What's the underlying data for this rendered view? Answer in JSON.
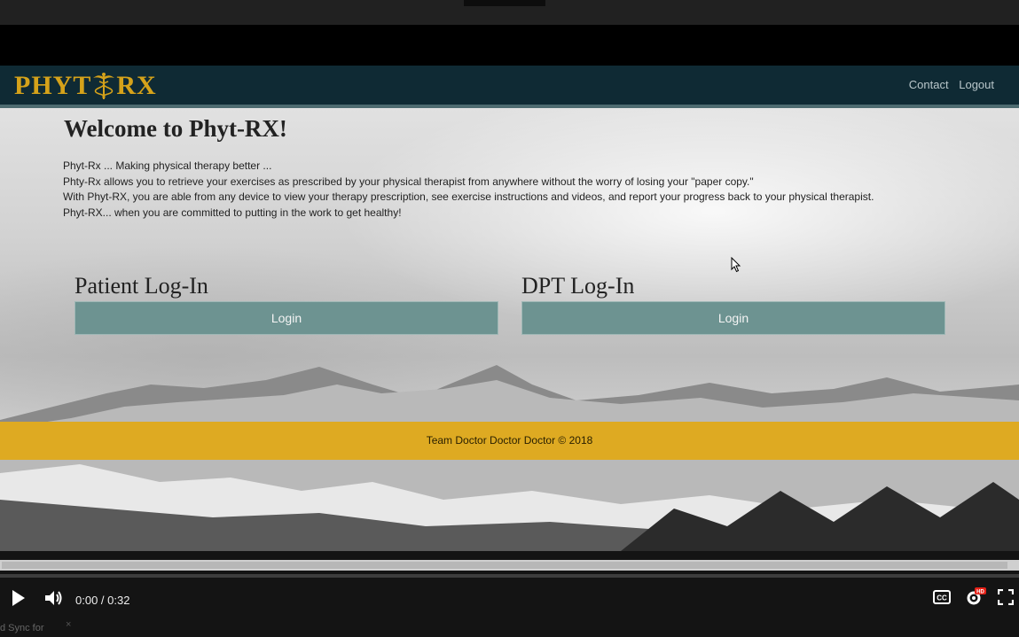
{
  "site": {
    "logo_text_left": "PHYT",
    "logo_text_right": "RX",
    "nav": {
      "contact": "Contact",
      "logout": "Logout"
    },
    "welcome": "Welcome to Phyt-RX!",
    "intro_lines": [
      "Phyt-Rx ... Making physical therapy better ...",
      "Phty-Rx allows you to retrieve your exercises as prescribed by your physical therapist from anywhere without the worry of losing your \"paper copy.\"",
      "With Phyt-RX, you are able from any device to view your therapy prescription, see exercise instructions and videos, and report your progress back to your physical therapist.",
      "Phyt-RX... when you are committed to putting in the work to get healthy!"
    ],
    "patient": {
      "title": "Patient Log-In",
      "button": "Login"
    },
    "dpt": {
      "title": "DPT Log-In",
      "button": "Login"
    },
    "footer": "Team Doctor Doctor Doctor © 2018"
  },
  "player": {
    "time": "0:00 / 0:32",
    "progress": 0,
    "badge": "HD"
  },
  "below": {
    "text": "d Sync for"
  },
  "colors": {
    "navbar": "#0f2a34",
    "logo": "#d5a21a",
    "button": "#6d9391",
    "footer": "#deaa22"
  },
  "icons": [
    "caduceus-icon",
    "cursor-icon",
    "play-icon",
    "volume-icon",
    "cc-icon",
    "settings-icon",
    "fullscreen-icon",
    "close-icon"
  ]
}
